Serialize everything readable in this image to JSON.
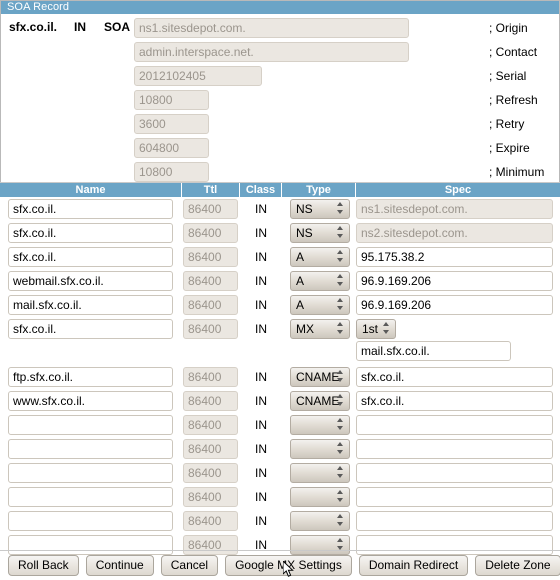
{
  "soa": {
    "title": "SOA Record",
    "record_name": "sfx.co.il.",
    "record_class": "IN",
    "record_type": "SOA",
    "fields": [
      {
        "value": "ns1.sitesdepot.com.",
        "label": "; Origin"
      },
      {
        "value": "admin.interspace.net.",
        "label": "; Contact"
      },
      {
        "value": "2012102405",
        "label": "; Serial"
      },
      {
        "value": "10800",
        "label": "; Refresh"
      },
      {
        "value": "3600",
        "label": "; Retry"
      },
      {
        "value": "604800",
        "label": "; Expire"
      },
      {
        "value": "10800",
        "label": "; Minimum"
      }
    ]
  },
  "table": {
    "headers": {
      "name": "Name",
      "ttl": "Ttl",
      "class": "Class",
      "type": "Type",
      "spec": "Spec"
    },
    "rows": [
      {
        "name": "sfx.co.il.",
        "ttl": "86400",
        "class": "IN",
        "type": "NS",
        "spec": "ns1.sitesdepot.com."
      },
      {
        "name": "sfx.co.il.",
        "ttl": "86400",
        "class": "IN",
        "type": "NS",
        "spec": "ns2.sitesdepot.com."
      },
      {
        "name": "sfx.co.il.",
        "ttl": "86400",
        "class": "IN",
        "type": "A",
        "spec": "95.175.38.2"
      },
      {
        "name": "webmail.sfx.co.il.",
        "ttl": "86400",
        "class": "IN",
        "type": "A",
        "spec": "96.9.169.206"
      },
      {
        "name": "mail.sfx.co.il.",
        "ttl": "86400",
        "class": "IN",
        "type": "A",
        "spec": "96.9.169.206"
      },
      {
        "name": "sfx.co.il.",
        "ttl": "86400",
        "class": "IN",
        "type": "MX",
        "priority": "1st",
        "spec": "mail.sfx.co.il."
      },
      {
        "name": "ftp.sfx.co.il.",
        "ttl": "86400",
        "class": "IN",
        "type": "CNAME",
        "spec": "sfx.co.il."
      },
      {
        "name": "www.sfx.co.il.",
        "ttl": "86400",
        "class": "IN",
        "type": "CNAME",
        "spec": "sfx.co.il."
      },
      {
        "name": "",
        "ttl": "86400",
        "class": "IN",
        "type": "",
        "spec": ""
      },
      {
        "name": "",
        "ttl": "86400",
        "class": "IN",
        "type": "",
        "spec": ""
      },
      {
        "name": "",
        "ttl": "86400",
        "class": "IN",
        "type": "",
        "spec": ""
      },
      {
        "name": "",
        "ttl": "86400",
        "class": "IN",
        "type": "",
        "spec": ""
      },
      {
        "name": "",
        "ttl": "86400",
        "class": "IN",
        "type": "",
        "spec": ""
      },
      {
        "name": "",
        "ttl": "86400",
        "class": "IN",
        "type": "",
        "spec": ""
      }
    ]
  },
  "footer": {
    "roll_back": "Roll Back",
    "continue": "Continue",
    "cancel": "Cancel",
    "google_mx": "Google MX Settings",
    "domain_redirect": "Domain Redirect",
    "delete_zone": "Delete Zone"
  },
  "colors": {
    "header_blue": "#6ba4c6",
    "disabled_field": "#ebe7e1"
  }
}
